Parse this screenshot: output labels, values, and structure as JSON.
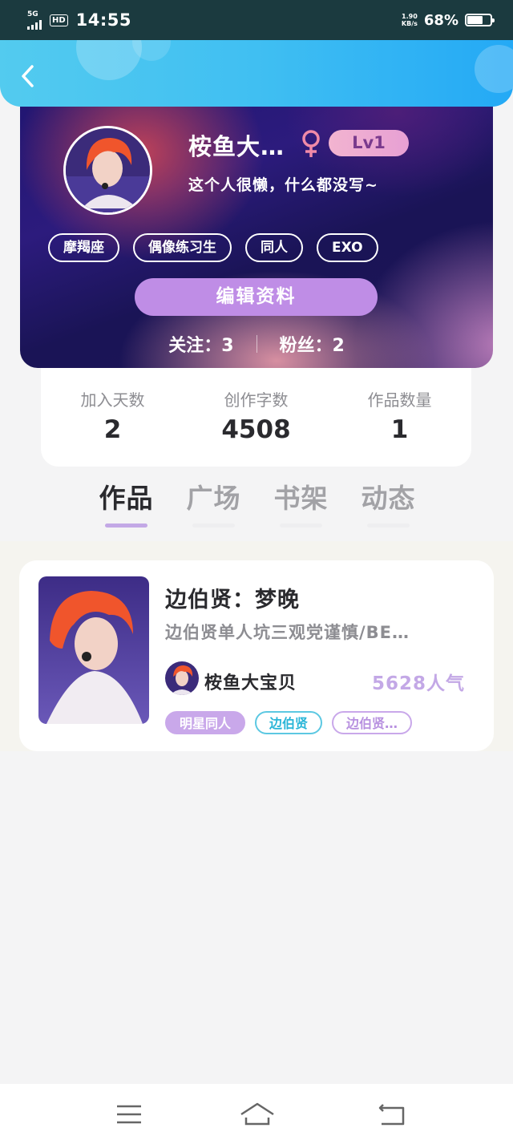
{
  "status_bar": {
    "network": "5G",
    "hd": "HD",
    "time": "14:55",
    "speed_value": "1.90",
    "speed_unit": "KB/s",
    "battery": "68%",
    "battery_level": 0.68
  },
  "profile": {
    "username": "桉鱼大…",
    "level": "Lv1",
    "bio": "这个人很懒，什么都没写~",
    "tags": [
      "摩羯座",
      "偶像练习生",
      "同人",
      "EXO"
    ],
    "edit_label": "编辑资料",
    "following": "关注：3",
    "followers": "粉丝：2"
  },
  "stats": [
    {
      "label": "加入天数",
      "value": "2"
    },
    {
      "label": "创作字数",
      "value": "4508"
    },
    {
      "label": "作品数量",
      "value": "1"
    }
  ],
  "tabs": [
    {
      "label": "作品",
      "active": true
    },
    {
      "label": "广场",
      "active": false
    },
    {
      "label": "书架",
      "active": false
    },
    {
      "label": "动态",
      "active": false
    }
  ],
  "work": {
    "title": "边伯贤：梦晚",
    "description": "边伯贤单人坑三观党谨慎/BE…",
    "author": "桉鱼大宝贝",
    "popularity": "5628人气",
    "tags": [
      "明星同人",
      "边伯贤",
      "边伯贤…"
    ]
  },
  "colors": {
    "header_blue": "#40bff2",
    "accent_purple": "#c3a8e6",
    "edit_button": "#bf8de6",
    "female_pink": "#f08aa8",
    "tag_cyan": "#2bb6d8"
  },
  "icons": {
    "back": "chevron-left-icon",
    "gender": "female-icon",
    "nav_menu": "menu-icon",
    "nav_home": "home-icon",
    "nav_back": "return-icon"
  }
}
